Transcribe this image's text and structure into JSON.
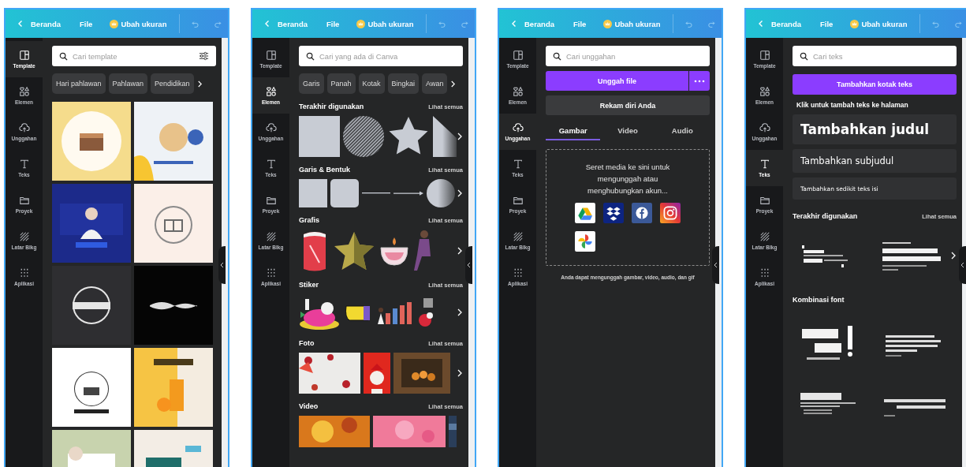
{
  "phones": [
    {
      "header": {
        "back": "Beranda",
        "file": "File",
        "resize": "Ubah ukuran"
      },
      "sidebar": [
        {
          "kind": "template",
          "label": "Template",
          "selected": true
        },
        {
          "kind": "elements",
          "label": "Elemen",
          "selected": false
        },
        {
          "kind": "uploads",
          "label": "Unggahan",
          "selected": false
        },
        {
          "kind": "text",
          "label": "Teks",
          "selected": false
        },
        {
          "kind": "projects",
          "label": "Proyek",
          "selected": false
        },
        {
          "kind": "background",
          "label": "Latar Blkg",
          "selected": false
        },
        {
          "kind": "apps",
          "label": "Aplikasi",
          "selected": false
        }
      ],
      "panel": {
        "kind": "templates",
        "search": {
          "placeholder": "Cari template",
          "filter": true
        },
        "chips": [
          "Hari pahlawan",
          "Pahlawan",
          "Pendidikan"
        ],
        "thumbnails": [
          {
            "kind": "picture"
          },
          {
            "kind": "picture"
          },
          {
            "kind": "picture"
          },
          {
            "kind": "picture"
          },
          {
            "kind": "picture"
          },
          {
            "kind": "picture"
          },
          {
            "kind": "picture"
          },
          {
            "kind": "picture"
          },
          {
            "kind": "picture"
          },
          {
            "kind": "picture"
          }
        ]
      }
    },
    {
      "header": {
        "back": "Beranda",
        "file": "File",
        "resize": "Ubah ukuran"
      },
      "sidebar": [
        {
          "kind": "template",
          "label": "Template",
          "selected": false
        },
        {
          "kind": "elements",
          "label": "Elemen",
          "selected": true
        },
        {
          "kind": "uploads",
          "label": "Unggahan",
          "selected": false
        },
        {
          "kind": "text",
          "label": "Teks",
          "selected": false
        },
        {
          "kind": "projects",
          "label": "Proyek",
          "selected": false
        },
        {
          "kind": "background",
          "label": "Latar Blkg",
          "selected": false
        },
        {
          "kind": "apps",
          "label": "Aplikasi",
          "selected": false
        }
      ],
      "panel": {
        "kind": "elements",
        "search": {
          "placeholder": "Cari yang ada di Canva"
        },
        "chips": [
          "Garis",
          "Panah",
          "Kotak",
          "Bingkai",
          "Awan"
        ],
        "sections": [
          {
            "kind": "recent-shapes",
            "title": "Terakhir digunakan",
            "link": "Lihat semua"
          },
          {
            "kind": "shapes",
            "title": "Garis & Bentuk",
            "link": "Lihat semua"
          },
          {
            "kind": "graphics",
            "title": "Grafis",
            "link": "Lihat semua"
          },
          {
            "kind": "stickers",
            "title": "Stiker",
            "link": "Lihat semua"
          },
          {
            "kind": "photos",
            "title": "Foto",
            "link": "Lihat semua"
          },
          {
            "kind": "videos",
            "title": "Video",
            "link": "Lihat semua"
          }
        ]
      }
    },
    {
      "header": {
        "back": "Beranda",
        "file": "File",
        "resize": "Ubah ukuran"
      },
      "sidebar": [
        {
          "kind": "template",
          "label": "Template",
          "selected": false
        },
        {
          "kind": "elements",
          "label": "Elemen",
          "selected": false
        },
        {
          "kind": "uploads",
          "label": "Unggahan",
          "selected": true
        },
        {
          "kind": "text",
          "label": "Teks",
          "selected": false
        },
        {
          "kind": "projects",
          "label": "Proyek",
          "selected": false
        },
        {
          "kind": "background",
          "label": "Latar Blkg",
          "selected": false
        },
        {
          "kind": "apps",
          "label": "Aplikasi",
          "selected": false
        }
      ],
      "panel": {
        "kind": "uploads",
        "search": {
          "placeholder": "Cari unggahan"
        },
        "upload_button": "Unggah file",
        "record_button": "Rekam diri Anda",
        "tabs": [
          {
            "label": "Gambar",
            "selected": true
          },
          {
            "label": "Video",
            "selected": false
          },
          {
            "label": "Audio",
            "selected": false
          }
        ],
        "dropzone": {
          "text": "Seret media ke sini untuk mengunggah atau menghubungkan akun...",
          "services": [
            {
              "kind": "triangle"
            },
            {
              "kind": "diamonds"
            },
            {
              "kind": "round"
            },
            {
              "kind": "camera"
            },
            {
              "kind": "pinwheel"
            }
          ]
        },
        "note": "Anda dapat mengunggah gambar, video, audio, dan gif"
      }
    },
    {
      "header": {
        "back": "Beranda",
        "file": "File",
        "resize": "Ubah ukuran"
      },
      "sidebar": [
        {
          "kind": "template",
          "label": "Template",
          "selected": false
        },
        {
          "kind": "elements",
          "label": "Elemen",
          "selected": false
        },
        {
          "kind": "uploads",
          "label": "Unggahan",
          "selected": false
        },
        {
          "kind": "text",
          "label": "Teks",
          "selected": true
        },
        {
          "kind": "projects",
          "label": "Proyek",
          "selected": false
        },
        {
          "kind": "background",
          "label": "Latar Blkg",
          "selected": false
        },
        {
          "kind": "apps",
          "label": "Aplikasi",
          "selected": false
        }
      ],
      "panel": {
        "kind": "text",
        "search": {
          "placeholder": "Cari teks"
        },
        "add_button": "Tambahkan kotak teks",
        "hint": "Klik untuk tambah teks ke halaman",
        "presets": [
          {
            "kind": "heading",
            "label": "Tambahkan judul"
          },
          {
            "kind": "subheading",
            "label": "Tambahkan subjudul"
          },
          {
            "kind": "body",
            "label": "Tambahkan sedikit teks isi"
          }
        ],
        "sections": [
          {
            "title": "Terakhir digunakan",
            "link": "Lihat semua",
            "previews": [
              {
                "kind": "picture"
              },
              {
                "kind": "picture"
              }
            ]
          },
          {
            "title": "Kombinasi font",
            "previews": [
              {
                "kind": "picture"
              },
              {
                "kind": "picture"
              },
              {
                "kind": "picture"
              },
              {
                "kind": "picture"
              }
            ]
          }
        ]
      }
    }
  ]
}
